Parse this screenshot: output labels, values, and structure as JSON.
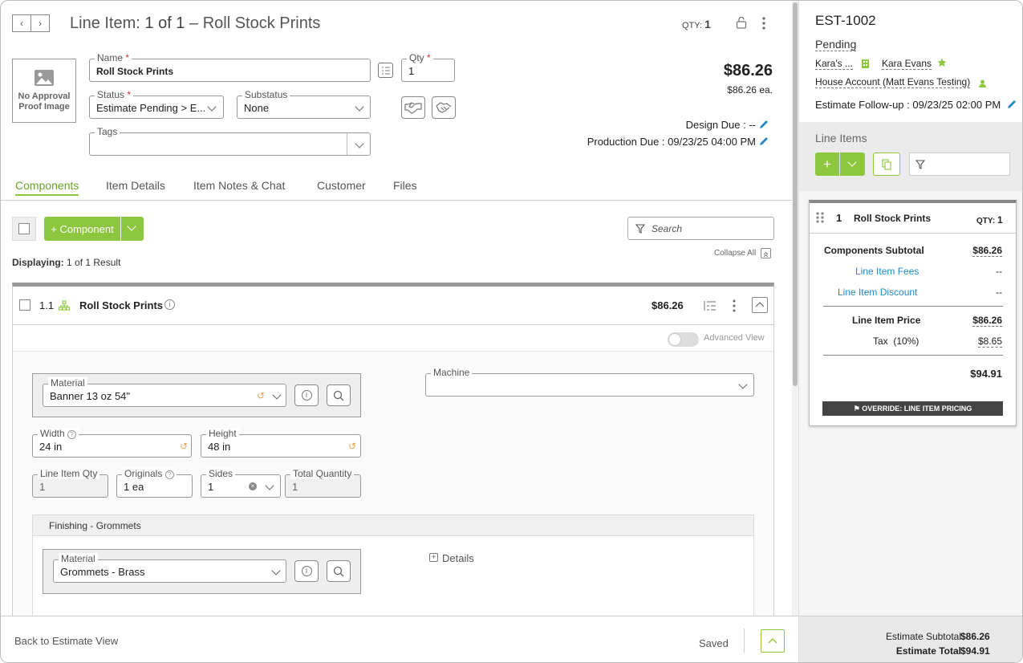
{
  "header": {
    "line_item_label": "Line Item:",
    "position": "1 of 1",
    "dash": "–",
    "item_name": "Roll Stock Prints",
    "qty_label": "QTY:",
    "qty_value": "1"
  },
  "image_placeholder": "No Approval Proof Image",
  "form": {
    "name_label": "Name",
    "name_value": "Roll Stock Prints",
    "qty_label": "Qty",
    "qty_value": "1",
    "status_label": "Status",
    "status_value": "Estimate Pending > E...",
    "substatus_label": "Substatus",
    "substatus_value": "None",
    "tags_label": "Tags",
    "required_mark": "*"
  },
  "pricing": {
    "price": "$86.26",
    "each": "$86.26 ea.",
    "design_due": "Design Due : --",
    "production_due": "Production Due : 09/23/25 04:00 PM"
  },
  "tabs": [
    "Components",
    "Item Details",
    "Item Notes & Chat",
    "Customer",
    "Files"
  ],
  "toolbar": {
    "component_button": "+ Component",
    "search_placeholder": "Search",
    "displaying_label": "Displaying:",
    "displaying_value": "1 of 1 Result",
    "collapse_all": "Collapse All"
  },
  "component": {
    "number": "1.1",
    "name": "Roll Stock Prints",
    "price": "$86.26",
    "advanced_view": "Advanced View",
    "material_label": "Material",
    "material_value": "Banner 13 oz 54\"",
    "machine_label": "Machine",
    "width_label": "Width",
    "width_value": "24 in",
    "height_label": "Height",
    "height_value": "48 in",
    "line_item_qty_label": "Line Item Qty",
    "line_item_qty_value": "1",
    "originals_label": "Originals",
    "originals_value": "1 ea",
    "sides_label": "Sides",
    "sides_value": "1",
    "total_quantity_label": "Total Quantity",
    "total_quantity_value": "1",
    "finishing_title": "Finishing - Grommets",
    "finishing_material_label": "Material",
    "finishing_material_value": "Grommets - Brass",
    "details_label": "Details"
  },
  "footer": {
    "back_link": "Back to Estimate View",
    "saved": "Saved"
  },
  "sidebar": {
    "estimate_id": "EST-1002",
    "status": "Pending",
    "company": "Kara's ...",
    "contact": "Kara Evans",
    "account": "House Account (Matt Evans Testing)",
    "follow_up": "Estimate Follow-up : 09/23/25 02:00 PM",
    "line_items_title": "Line Items",
    "card": {
      "number": "1",
      "name": "Roll Stock Prints",
      "qty_label": "QTY:",
      "qty_value": "1",
      "components_subtotal_label": "Components Subtotal",
      "components_subtotal": "$86.26",
      "fees_label": "Line Item Fees",
      "fees": "--",
      "discount_label": "Line Item Discount",
      "discount": "--",
      "line_item_price_label": "Line Item Price",
      "line_item_price": "$86.26",
      "tax_label": "Tax",
      "tax_rate": "(10%)",
      "tax": "$8.65",
      "total": "$94.91",
      "override_label": "OVERRIDE: LINE ITEM PRICING"
    },
    "estimate_subtotal_label": "Estimate Subtotal",
    "estimate_subtotal": "$86.26",
    "estimate_total_label": "Estimate Total",
    "estimate_total": "$94.91"
  },
  "colors": {
    "accent": "#8dc63f",
    "link": "#1e88c7"
  }
}
